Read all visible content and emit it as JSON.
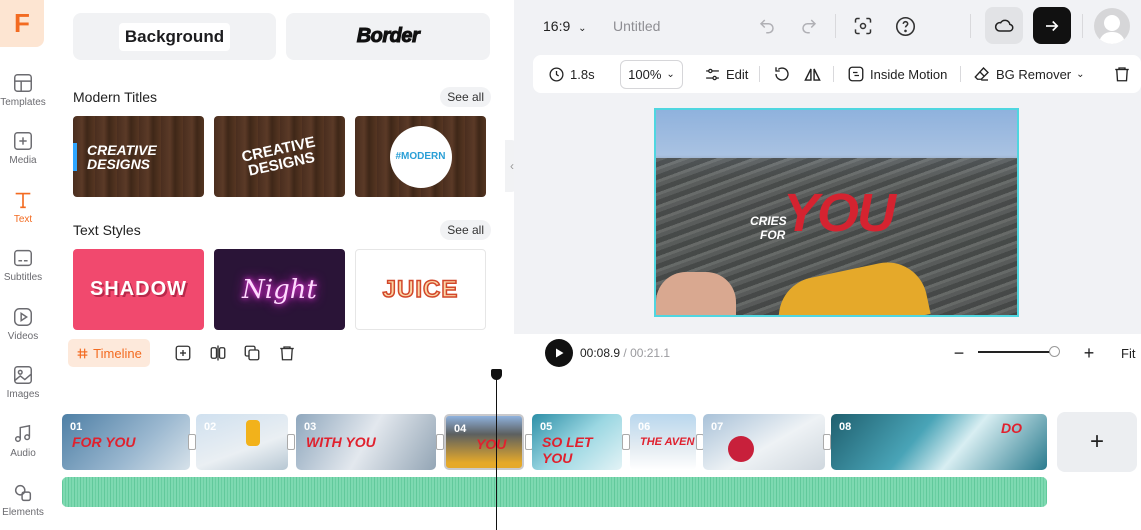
{
  "app": {
    "logo_letter": "F",
    "accent": "#f36b21"
  },
  "rail": [
    {
      "label": "Templates",
      "icon": "templates-icon"
    },
    {
      "label": "Media",
      "icon": "media-plus-icon"
    },
    {
      "label": "Text",
      "icon": "text-icon",
      "active": true
    },
    {
      "label": "Subtitles",
      "icon": "subtitles-icon"
    },
    {
      "label": "Videos",
      "icon": "videos-icon"
    },
    {
      "label": "Images",
      "icon": "images-icon"
    },
    {
      "label": "Audio",
      "icon": "audio-icon"
    },
    {
      "label": "Elements",
      "icon": "elements-icon"
    }
  ],
  "panel": {
    "top_buttons": [
      "Background",
      "Border"
    ],
    "modern_titles": {
      "title": "Modern Titles",
      "see_all": "See all",
      "items": [
        "CREATIVE DESIGNS",
        "CREATIVE DESIGNS",
        "#MODERN"
      ]
    },
    "text_styles": {
      "title": "Text Styles",
      "see_all": "See all",
      "items": [
        "SHADOW",
        "Night",
        "JUICE"
      ]
    }
  },
  "topbar": {
    "aspect": "16:9",
    "project_title": "Untitled"
  },
  "toolbar": {
    "duration": "1.8s",
    "zoom": "100%",
    "edit": "Edit",
    "inside_motion": "Inside Motion",
    "bg_remover": "BG Remover"
  },
  "canvas": {
    "small_text_1": "CRIES",
    "small_text_2": "FOR",
    "big_text": "YOU"
  },
  "timeline": {
    "label": "Timeline",
    "current_time": "00:08.9",
    "separator": " / ",
    "total_time": "00:21.1",
    "fit": "Fit"
  },
  "clips": [
    {
      "num": "01",
      "text": "FOR YOU"
    },
    {
      "num": "02",
      "text": ""
    },
    {
      "num": "03",
      "text": "WITH YOU"
    },
    {
      "num": "04",
      "text": "YOU"
    },
    {
      "num": "05",
      "text": "SO LET YOU"
    },
    {
      "num": "06",
      "text": "THE AVEN"
    },
    {
      "num": "07",
      "text": ""
    },
    {
      "num": "08",
      "text": "DO"
    }
  ]
}
